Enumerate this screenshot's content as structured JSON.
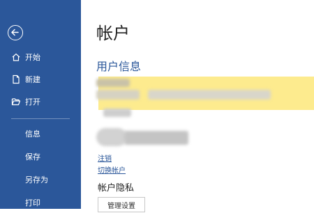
{
  "sidebar": {
    "back_icon": "back-arrow-icon",
    "items": [
      {
        "label": "开始",
        "icon": "home-icon"
      },
      {
        "label": "新建",
        "icon": "new-document-icon"
      },
      {
        "label": "打开",
        "icon": "open-folder-icon"
      },
      {
        "label": "信息"
      },
      {
        "label": "保存"
      },
      {
        "label": "另存为"
      },
      {
        "label": "打印"
      }
    ]
  },
  "main": {
    "title": "帐户",
    "user_info_title": "用户信息",
    "links": [
      "注销",
      "切换帐户"
    ],
    "privacy_title": "帐户隐私",
    "manage_button": "管理设置"
  },
  "colors": {
    "sidebar_bg": "#2b579a",
    "accent": "#2b579a",
    "highlight": "#fdeb8e"
  }
}
